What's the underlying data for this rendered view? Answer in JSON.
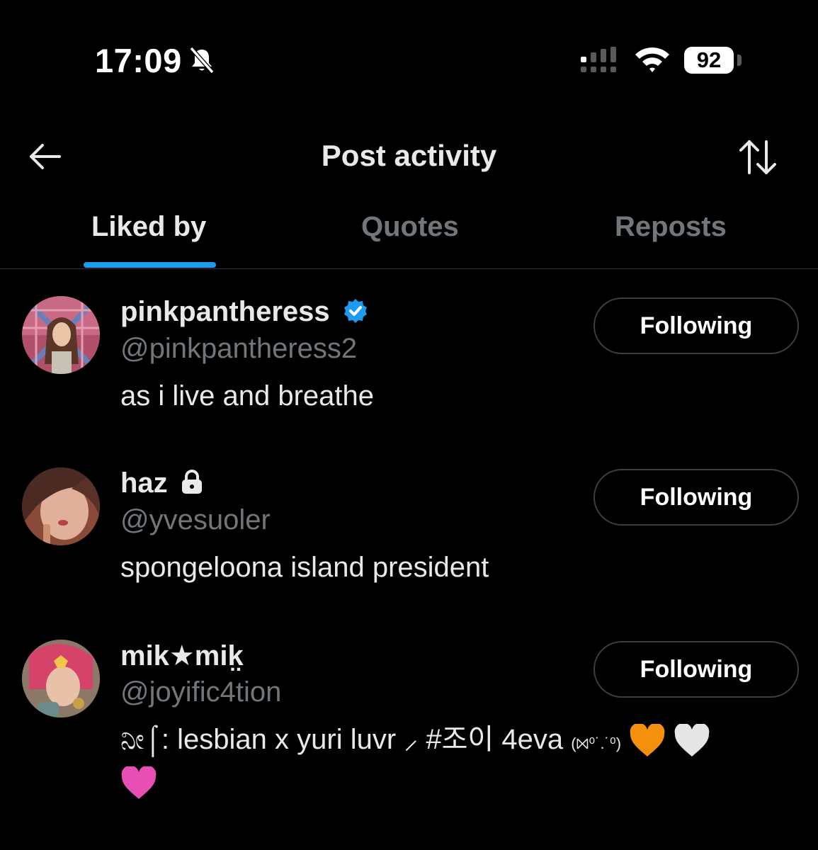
{
  "status_bar": {
    "time": "17:09",
    "battery": "92"
  },
  "header": {
    "title": "Post activity"
  },
  "tabs": [
    {
      "label": "Liked by",
      "active": true
    },
    {
      "label": "Quotes",
      "active": false
    },
    {
      "label": "Reposts",
      "active": false
    }
  ],
  "users": [
    {
      "display_name": "pinkpantheress",
      "handle": "@pinkpantheress2",
      "bio": "as i live and breathe",
      "follow_label": "Following",
      "badge": "verified-badge-icon"
    },
    {
      "display_name": "haz",
      "handle": "@yvesuoler",
      "bio": "spongeloona island president",
      "follow_label": "Following",
      "badge": "lock-icon"
    },
    {
      "display_name": "mik★mik̤",
      "handle": "@joyific4tion",
      "bio_part1": "ನೀ⌠: lesbian x yuri luvr ⸝ #조이 4eva ",
      "bio_part2": "(⨝⁰˙.˙⁰)",
      "follow_label": "Following",
      "badge": ""
    }
  ],
  "colors": {
    "accent": "#1d9bf0",
    "orange_heart": "#f4900c",
    "white_heart": "#e6e6e6",
    "pink_heart": "#e84fb5"
  }
}
